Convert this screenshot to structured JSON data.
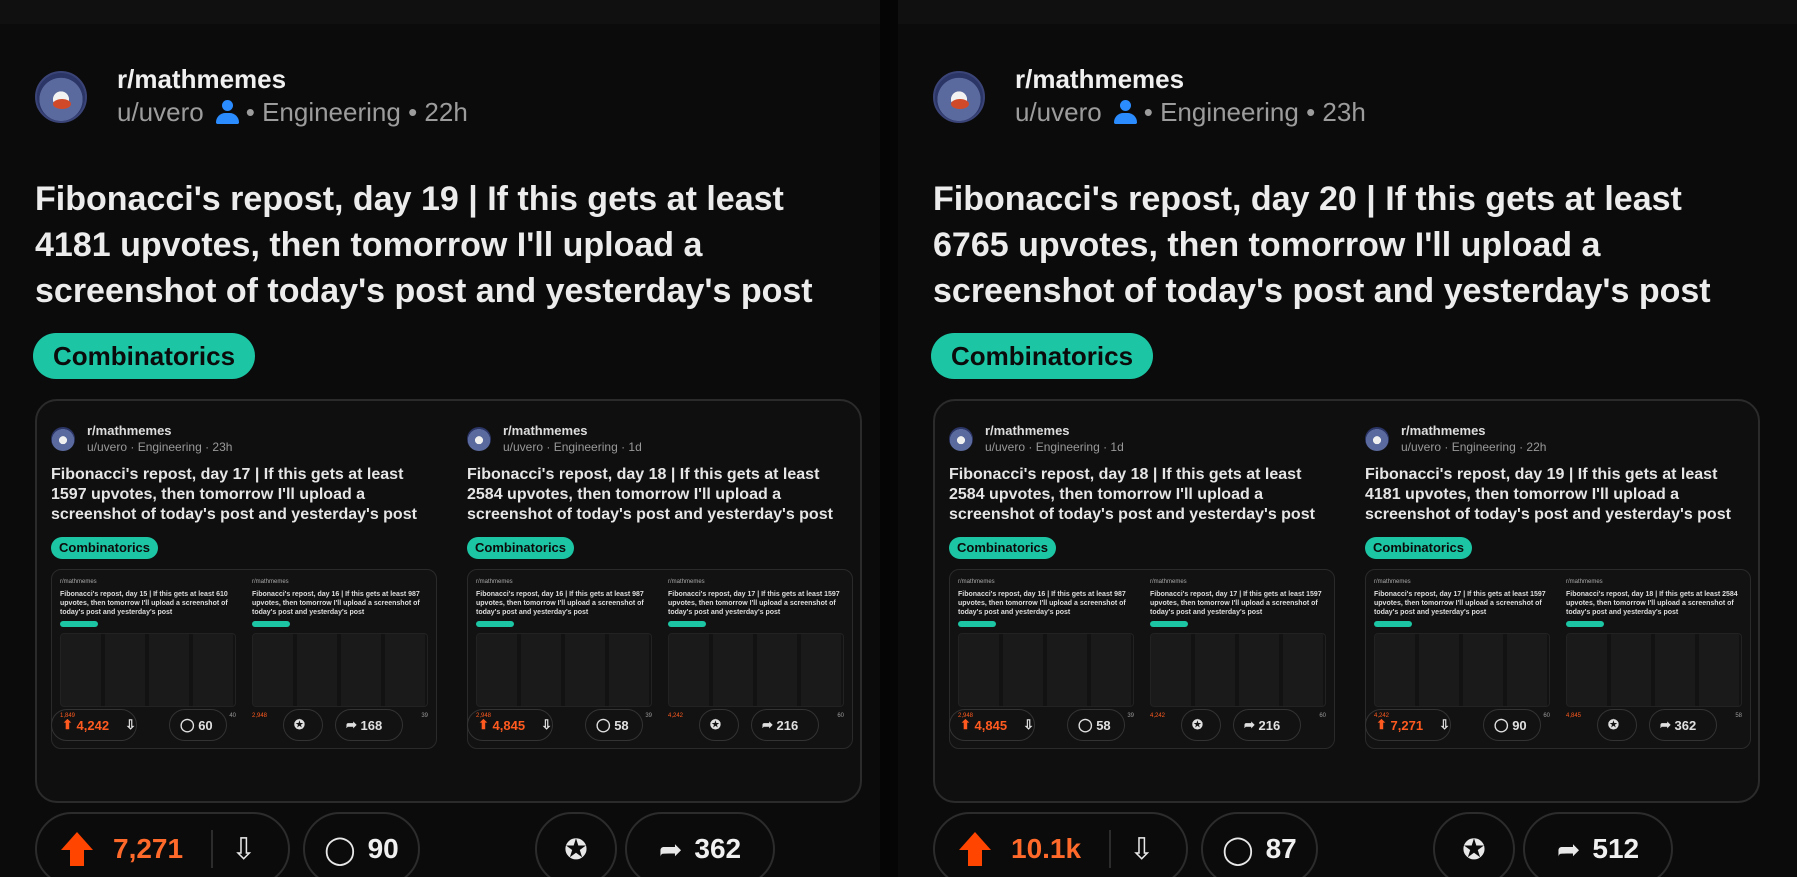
{
  "panels": [
    {
      "subreddit": "r/mathmemes",
      "user": "u/uvero",
      "flair_group": "Engineering",
      "time": "22h",
      "title": "Fibonacci's repost, day 19 | If this gets at least 4181 upvotes, then tomorrow I'll upload a screenshot of today's post and yesterday's post",
      "flair": "Combinatorics",
      "upvotes": "7,271",
      "comments": "90",
      "shares": "362",
      "embedded": [
        {
          "subreddit": "r/mathmemes",
          "meta": "u/uvero · Engineering · 23h",
          "title": "Fibonacci's repost, day 17 | If this gets at least 1597 upvotes, then tomorrow I'll upload a screenshot of today's post and yesterday's post",
          "flair": "Combinatorics",
          "upvotes": "4,242",
          "comments": "60",
          "shares": "168",
          "inner": [
            {
              "title": "Fibonacci's repost, day 15 | If this gets at least 610 upvotes, then tomorrow I'll upload a screenshot of today's post and yesterday's post",
              "upvotes": "1,849",
              "comments": "40"
            },
            {
              "title": "Fibonacci's repost, day 16 | If this gets at least 987 upvotes, then tomorrow I'll upload a screenshot of today's post and yesterday's post",
              "upvotes": "2,948",
              "comments": "39"
            }
          ]
        },
        {
          "subreddit": "r/mathmemes",
          "meta": "u/uvero · Engineering · 1d",
          "title": "Fibonacci's repost, day 18 | If this gets at least 2584 upvotes, then tomorrow I'll upload a screenshot of today's post and yesterday's post",
          "flair": "Combinatorics",
          "upvotes": "4,845",
          "comments": "58",
          "shares": "216",
          "inner": [
            {
              "title": "Fibonacci's repost, day 16 | If this gets at least 987 upvotes, then tomorrow I'll upload a screenshot of today's post and yesterday's post",
              "upvotes": "2,948",
              "comments": "39"
            },
            {
              "title": "Fibonacci's repost, day 17 | If this gets at least 1597 upvotes, then tomorrow I'll upload a screenshot of today's post and yesterday's post",
              "upvotes": "4,242",
              "comments": "60"
            }
          ]
        }
      ]
    },
    {
      "subreddit": "r/mathmemes",
      "user": "u/uvero",
      "flair_group": "Engineering",
      "time": "23h",
      "title": "Fibonacci's repost, day 20 | If this gets at least 6765 upvotes, then tomorrow I'll upload a screenshot of today's post and yesterday's post",
      "flair": "Combinatorics",
      "upvotes": "10.1k",
      "comments": "87",
      "shares": "512",
      "embedded": [
        {
          "subreddit": "r/mathmemes",
          "meta": "u/uvero · Engineering · 1d",
          "title": "Fibonacci's repost, day 18 | If this gets at least 2584 upvotes, then tomorrow I'll upload a screenshot of today's post and yesterday's post",
          "flair": "Combinatorics",
          "upvotes": "4,845",
          "comments": "58",
          "shares": "216",
          "inner": [
            {
              "title": "Fibonacci's repost, day 16 | If this gets at least 987 upvotes, then tomorrow I'll upload a screenshot of today's post and yesterday's post",
              "upvotes": "2,948",
              "comments": "39"
            },
            {
              "title": "Fibonacci's repost, day 17 | If this gets at least 1597 upvotes, then tomorrow I'll upload a screenshot of today's post and yesterday's post",
              "upvotes": "4,242",
              "comments": "60"
            }
          ]
        },
        {
          "subreddit": "r/mathmemes",
          "meta": "u/uvero · Engineering · 22h",
          "title": "Fibonacci's repost, day 19 | If this gets at least 4181 upvotes, then tomorrow I'll upload a screenshot of today's post and yesterday's post",
          "flair": "Combinatorics",
          "upvotes": "7,271",
          "comments": "90",
          "shares": "362",
          "inner": [
            {
              "title": "Fibonacci's repost, day 17 | If this gets at least 1597 upvotes, then tomorrow I'll upload a screenshot of today's post and yesterday's post",
              "upvotes": "4,242",
              "comments": "60"
            },
            {
              "title": "Fibonacci's repost, day 18 | If this gets at least 2584 upvotes, then tomorrow I'll upload a screenshot of today's post and yesterday's post",
              "upvotes": "4,845",
              "comments": "58"
            }
          ]
        }
      ]
    }
  ],
  "icons": {
    "upvote": "arrow-up-icon",
    "downvote": "arrow-down-icon",
    "comment": "comment-bubble-icon",
    "award": "award-icon",
    "share": "share-arrow-icon",
    "user": "user-icon"
  },
  "colors": {
    "background": "#0b0b0b",
    "flair": "#1cc6a4",
    "upvote": "#ff4500",
    "user_icon": "#2b8cff"
  }
}
